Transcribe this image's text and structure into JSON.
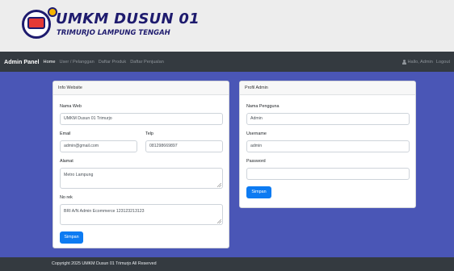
{
  "logo": {
    "title": "UMKM DUSUN 01",
    "subtitle": "TRIMURJO LAMPUNG TENGAH"
  },
  "navbar": {
    "brand": "Admin Panel",
    "links": [
      {
        "label": "Home",
        "active": true
      },
      {
        "label": "User / Pelanggan",
        "active": false
      },
      {
        "label": "Daftar Produk",
        "active": false
      },
      {
        "label": "Daftar Penjualan",
        "active": false
      }
    ],
    "greeting": "Hallo, Admin",
    "logout": "Logout",
    "user_icon": "user-icon"
  },
  "info_website": {
    "title": "Info Website",
    "nama_web_label": "Nama Web",
    "nama_web_value": "UMKM Dusun 01 Trimurjo",
    "email_label": "Email",
    "email_value": "admin@gmail.com",
    "telp_label": "Telp",
    "telp_value": "081298669897",
    "alamat_label": "Alamat",
    "alamat_value": "Metro Lampung",
    "norek_label": "No rek",
    "norek_value": "BRI A/N Admin Ecommerce 123123213123",
    "save_label": "Simpan"
  },
  "profil_admin": {
    "title": "Profil Admin",
    "nama_label": "Nama Pengguna",
    "nama_value": "Admin",
    "username_label": "Username",
    "username_value": "admin",
    "password_label": "Password",
    "password_value": "",
    "save_label": "Simpan"
  },
  "footer": {
    "text": "Copyright 2025 UMKM Dusun 01 Trimurjo All Reserved"
  },
  "colors": {
    "main_bg": "#4a56b6",
    "navbar_bg": "#343a40",
    "button": "#0d7bf2",
    "logo": "#1e1b6e"
  }
}
